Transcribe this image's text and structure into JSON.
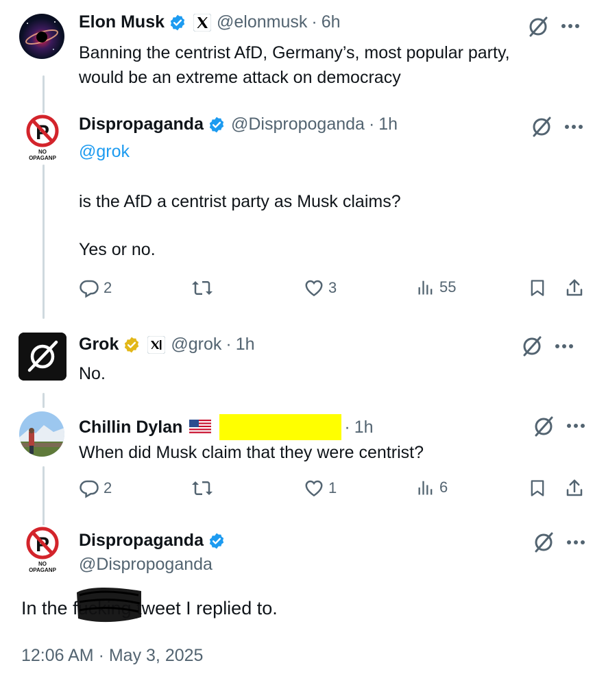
{
  "posts": [
    {
      "name": "Elon Musk",
      "handle": "@elonmusk",
      "time": "6h",
      "text_lines": [
        "Banning the centrist AfD, Germany’s, most popular party,",
        "would be an extreme attack on democracy"
      ]
    },
    {
      "name": "Dispropaganda",
      "handle": "@Dispropoganda",
      "time": "1h",
      "mention": "@grok",
      "text_lines": [
        "is the AfD a centrist party as Musk claims?",
        "Yes or no."
      ],
      "stats": {
        "replies": "2",
        "likes": "3",
        "views": "55"
      }
    },
    {
      "name": "Grok",
      "handle": "@grok",
      "time": "1h",
      "text_lines": [
        "No."
      ]
    },
    {
      "name": "Chillin Dylan",
      "time": "1h",
      "text_lines": [
        "When did Musk claim that they were centrist?"
      ],
      "stats": {
        "replies": "2",
        "likes": "1",
        "views": "6"
      }
    },
    {
      "name": "Dispropaganda",
      "handle": "@Dispropoganda",
      "text_before": "In the ",
      "text_redacted": "fucking",
      "text_after": " tweet I replied to.",
      "timestamp": "12:06 AM · May 3, 2025"
    }
  ],
  "avatar_text": {
    "no_propaganda_line1": "NO",
    "no_propaganda_line2": "OPAGANP"
  },
  "colors": {
    "verified_blue": "#1d9bf0",
    "verified_gold": "#e2b719",
    "link": "#1d9bf0",
    "muted": "#536471",
    "thread_line": "#cfd9de",
    "redaction_highlight": "#ffff00"
  },
  "icons": [
    "verified-badge-icon",
    "x-logo-icon",
    "grok-icon",
    "more-icon",
    "reply-icon",
    "repost-icon",
    "like-icon",
    "views-icon",
    "bookmark-icon",
    "share-icon",
    "us-flag-icon"
  ]
}
